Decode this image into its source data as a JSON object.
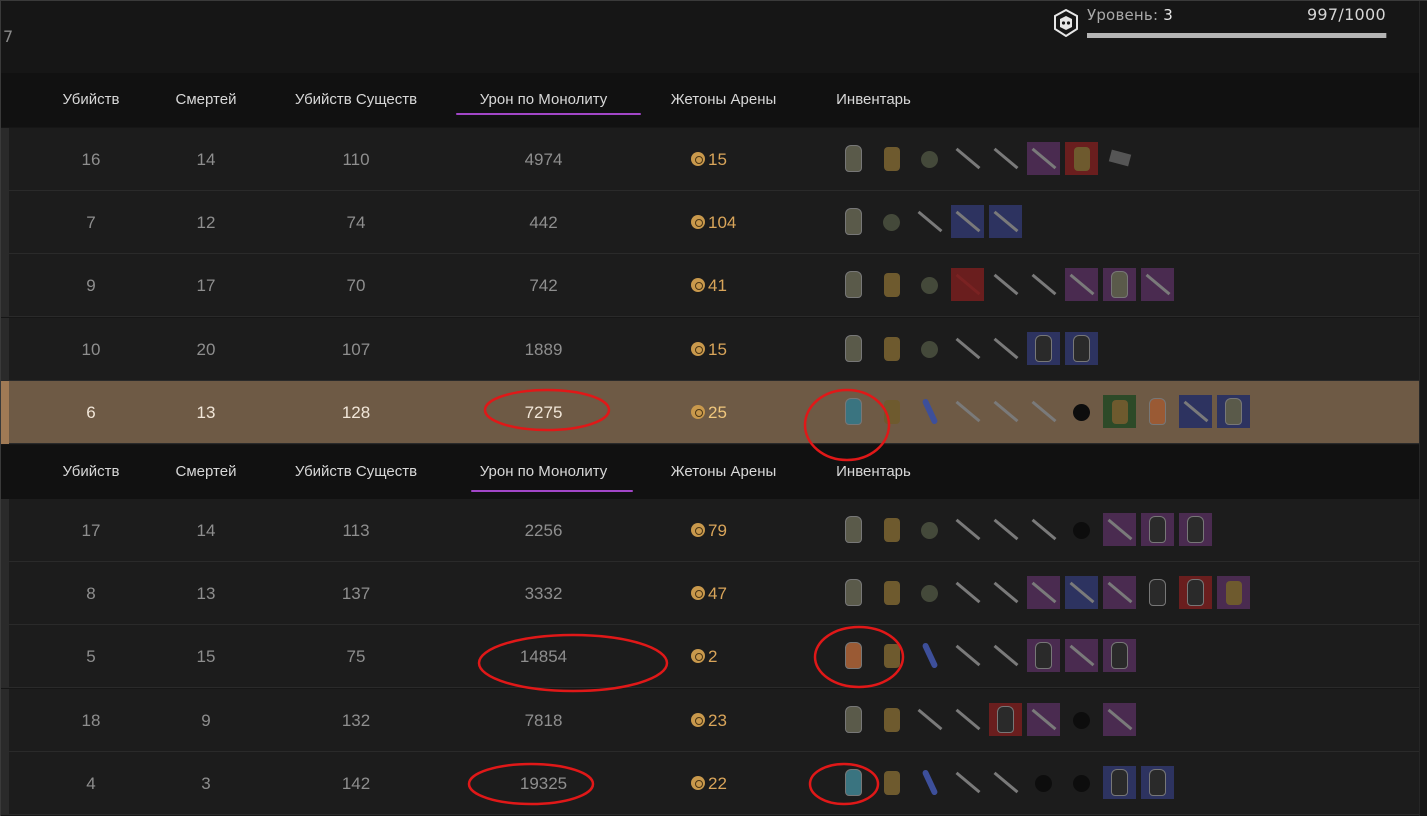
{
  "corner": {
    "number": "7"
  },
  "level": {
    "label": "Уровень:",
    "value": "3",
    "xp_text": "997/1000",
    "xp_fraction": 0.997
  },
  "columns": [
    "Убийств",
    "Смертей",
    "Убийств Существ",
    "Урон по Монолиту",
    "Жетоны Арены",
    "Инвентарь"
  ],
  "team1": [
    {
      "kills": "16",
      "deaths": "14",
      "creature_kills": "110",
      "damage": "4974",
      "tokens": "15",
      "items": [
        "armor",
        "backpack",
        "grenade",
        "rifle",
        "pistol",
        "rifle-purple",
        "container-red",
        "document"
      ]
    },
    {
      "kills": "7",
      "deaths": "12",
      "creature_kills": "74",
      "damage": "442",
      "tokens": "104",
      "items": [
        "armor",
        "grenade",
        "knife",
        "rifle-blue",
        "smg-blue"
      ]
    },
    {
      "kills": "9",
      "deaths": "17",
      "creature_kills": "70",
      "damage": "742",
      "tokens": "41",
      "items": [
        "armor",
        "backpack",
        "grenade",
        "knife-red",
        "rifle",
        "shotgun",
        "rifle-purple",
        "armor-purple",
        "smg-purple"
      ]
    },
    {
      "kills": "10",
      "deaths": "20",
      "creature_kills": "107",
      "damage": "1889",
      "tokens": "15",
      "items": [
        "armor",
        "backpack",
        "grenade",
        "rifle",
        "pistol",
        "helmet-blue",
        "helmet-blue"
      ]
    },
    {
      "kills": "6",
      "deaths": "13",
      "creature_kills": "128",
      "damage": "7275",
      "tokens": "25",
      "highlighted": true,
      "items": [
        "armor-teal",
        "backpack",
        "syringe",
        "knife",
        "rifle",
        "shotgun",
        "artifact",
        "container-green",
        "armor-orange",
        "smg-blue",
        "armor-blue"
      ]
    }
  ],
  "team2": [
    {
      "kills": "17",
      "deaths": "14",
      "creature_kills": "113",
      "damage": "2256",
      "tokens": "79",
      "items": [
        "armor",
        "backpack",
        "grenade",
        "knife",
        "rifle",
        "pistol",
        "artifact-teal",
        "smg-purple",
        "helmet-purple",
        "helmet-purple"
      ]
    },
    {
      "kills": "8",
      "deaths": "13",
      "creature_kills": "137",
      "damage": "3332",
      "tokens": "47",
      "items": [
        "armor",
        "backpack",
        "grenade",
        "knife",
        "pistol",
        "smg-purple",
        "rifle-blue",
        "smg-purple",
        "helmet",
        "helmet-red",
        "container-purple"
      ]
    },
    {
      "kills": "5",
      "deaths": "15",
      "creature_kills": "75",
      "damage": "14854",
      "tokens": "2",
      "items": [
        "armor-orange",
        "backpack",
        "syringe",
        "smg",
        "pistol",
        "helmet-purple",
        "rifle-purple",
        "helmet-purple"
      ]
    },
    {
      "kills": "18",
      "deaths": "9",
      "creature_kills": "132",
      "damage": "7818",
      "tokens": "23",
      "items": [
        "armor",
        "backpack",
        "knife",
        "revolver",
        "helmet-red",
        "rifle-purple",
        "artifact",
        "smg-purple"
      ]
    },
    {
      "kills": "4",
      "deaths": "3",
      "creature_kills": "142",
      "damage": "19325",
      "tokens": "22",
      "items": [
        "armor-teal",
        "backpack",
        "syringe",
        "smg",
        "pistol",
        "artifact-orange",
        "artifact",
        "helmet-blue",
        "helmet-blue"
      ]
    }
  ],
  "colors": {
    "accent_underline": "#a246c8",
    "highlight_row": "#6e5a45",
    "token": "#d9a55a",
    "annotation": "#e01818"
  }
}
